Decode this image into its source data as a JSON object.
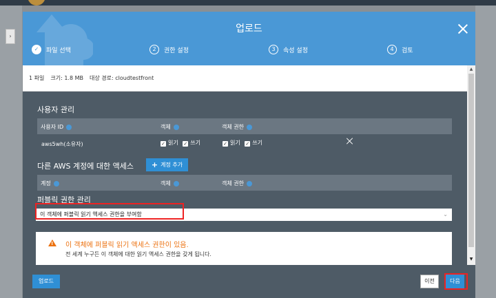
{
  "dialog": {
    "title": "업로드"
  },
  "steps": [
    {
      "num": "✓",
      "label": "파일 선택"
    },
    {
      "num": "2",
      "label": "권한 설정"
    },
    {
      "num": "3",
      "label": "속성 설정"
    },
    {
      "num": "4",
      "label": "검토"
    }
  ],
  "file_info": {
    "count": "1 파일",
    "size": "크기: 1.8 MB",
    "target": "대상 경로: cloudtestfront"
  },
  "user_mgmt": {
    "title": "사용자 관리",
    "columns": [
      "사용자 ID",
      "객체",
      "객체 권한"
    ],
    "row": {
      "user": "aws5wh(소유자)",
      "object_read": "읽기",
      "object_write": "쓰기",
      "perm_read": "읽기",
      "perm_write": "쓰기"
    }
  },
  "other_accounts": {
    "title": "다른 AWS 계정에 대한 액세스",
    "add_button": "계정 추가",
    "columns": [
      "계정",
      "객체",
      "객체 권한"
    ]
  },
  "public": {
    "title": "퍼블릭 권한 관리",
    "selected": "이 객체에 퍼블릭 읽기 액세스 권한을 부여함",
    "warning_title": "이 객체에 퍼블릭 읽기 액세스 권한이 있음.",
    "warning_desc": "전 세계 누구든 이 객체에 대한 읽기 액세스 권한을 갖게 됩니다."
  },
  "footer": {
    "upload": "업로드",
    "prev": "이전",
    "next": "다음"
  },
  "colors": {
    "header": "#4a98d6",
    "body": "#4e5b66",
    "accent": "#2f8fd5",
    "warning": "#ec7211",
    "highlight": "#e22222"
  }
}
